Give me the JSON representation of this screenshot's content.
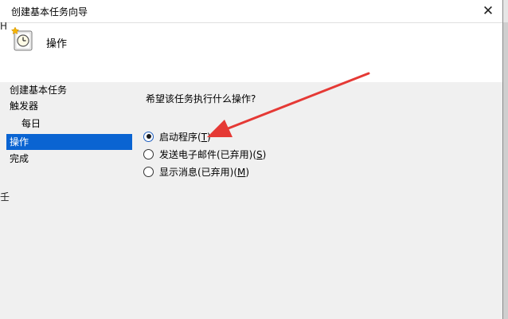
{
  "window": {
    "title": "创建基本任务向导",
    "close_glyph": "✕"
  },
  "header": {
    "title": "操作"
  },
  "background_fragments": {
    "h_char": "H",
    "gear_char": "壬"
  },
  "nav": {
    "items": [
      {
        "label": "创建基本任务"
      },
      {
        "label": "触发器"
      },
      {
        "label": "每日"
      },
      {
        "label": "操作"
      },
      {
        "label": "完成"
      }
    ]
  },
  "main": {
    "question": "希望该任务执行什么操作?",
    "options": [
      {
        "text": "启动程序(",
        "key": "T",
        "close": ")",
        "checked": true
      },
      {
        "text": "发送电子邮件(已弃用)(",
        "key": "S",
        "close": ")",
        "checked": false
      },
      {
        "text": "显示消息(已弃用)(",
        "key": "M",
        "close": ")",
        "checked": false
      }
    ]
  },
  "colors": {
    "selection": "#0a64d2",
    "arrow": "#e53935"
  },
  "icons": {
    "header": "task-clock-icon",
    "close": "close-icon",
    "arrow": "red-arrow-annotation"
  }
}
